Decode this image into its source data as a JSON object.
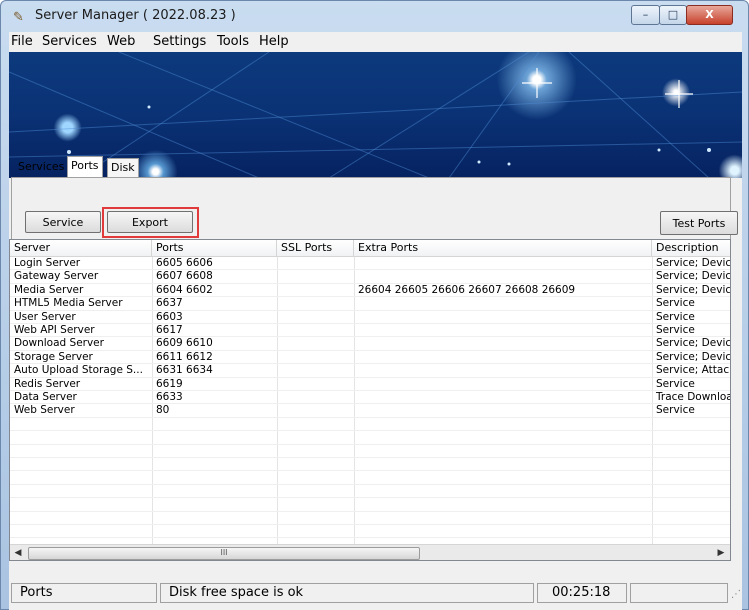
{
  "window": {
    "title": "Server Manager ( 2022.08.23 )",
    "close_label": "X",
    "minimize_label": "–",
    "maximize_label": "□"
  },
  "menu": [
    "File",
    "Services",
    "Web",
    "Settings",
    "Tools",
    "Help"
  ],
  "tabs": [
    {
      "label": "Services"
    },
    {
      "label": "Ports"
    },
    {
      "label": "Disk Info"
    }
  ],
  "toolbar": {
    "service_config_label": "Service Config",
    "export_label": "Export",
    "test_ports_label": "Test Ports"
  },
  "table": {
    "columns": [
      "Server",
      "Ports",
      "SSL Ports",
      "Extra Ports",
      "Description"
    ],
    "rows": [
      [
        "Login Server",
        "6605 6606",
        "",
        "",
        "Service; Device"
      ],
      [
        "Gateway Server",
        "6607 6608",
        "",
        "",
        "Service; Device"
      ],
      [
        "Media Server",
        "6604 6602",
        "",
        "26604 26605 26606 26607 26608 26609",
        "Service; Device; W"
      ],
      [
        "HTML5 Media Server",
        "6637",
        "",
        "",
        "Service"
      ],
      [
        "User Server",
        "6603",
        "",
        "",
        "Service"
      ],
      [
        "Web API Server",
        "6617",
        "",
        "",
        "Service"
      ],
      [
        "Download Server",
        "6609 6610",
        "",
        "",
        "Service; Device"
      ],
      [
        "Storage Server",
        "6611 6612",
        "",
        "",
        "Service; Device"
      ],
      [
        "Auto Upload Storage S...",
        "6631 6634",
        "",
        "",
        "Service; Attachme"
      ],
      [
        "Redis Server",
        "6619",
        "",
        "",
        "Service"
      ],
      [
        "Data Server",
        "6633",
        "",
        "",
        "Trace Download"
      ],
      [
        "Web Server",
        "80",
        "",
        "",
        "Service"
      ]
    ]
  },
  "scrollbar": {
    "left_arrow": "◀",
    "right_arrow": "▶",
    "thumb_label": "III"
  },
  "status": {
    "panel1": "Ports",
    "panel2": "Disk free space is ok",
    "panel3": "00:25:18"
  }
}
